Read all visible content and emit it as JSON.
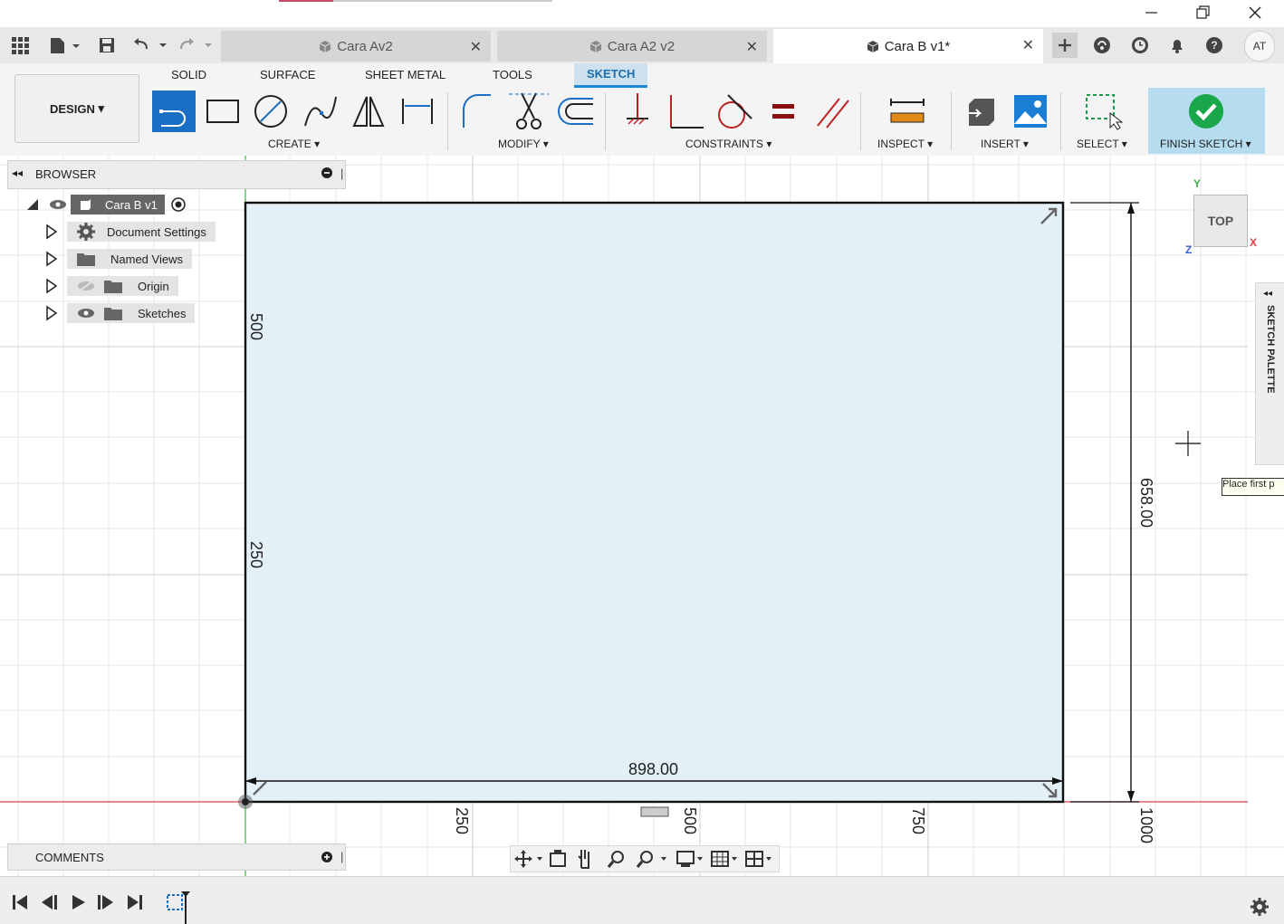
{
  "tabs": [
    {
      "label": "Cara Av2",
      "active": false
    },
    {
      "label": "Cara A2 v2",
      "active": false
    },
    {
      "label": "Cara B v1*",
      "active": true
    }
  ],
  "user_initials": "AT",
  "workspace_tabs": [
    "SOLID",
    "SURFACE",
    "SHEET METAL",
    "TOOLS",
    "SKETCH"
  ],
  "design_label": "DESIGN",
  "groups": {
    "create": "CREATE",
    "modify": "MODIFY",
    "constraints": "CONSTRAINTS",
    "inspect": "INSPECT",
    "insert": "INSERT",
    "select": "SELECT",
    "finish": "FINISH SKETCH"
  },
  "browser": {
    "title": "BROWSER",
    "root": "Cara B v1",
    "items": [
      "Document Settings",
      "Named Views",
      "Origin",
      "Sketches"
    ]
  },
  "comments_label": "COMMENTS",
  "viewcube": {
    "face": "TOP",
    "x": "X",
    "y": "Y",
    "z": "Z"
  },
  "sketch_palette": "SKETCH PALETTE",
  "tooltip": "Place first p",
  "dimensions": {
    "width": "898.00",
    "height": "658.00"
  },
  "ruler": {
    "x_ticks": [
      "250",
      "500",
      "750",
      "1000"
    ],
    "y_ticks": [
      "500",
      "250"
    ]
  },
  "colors": {
    "accent": "#1a8ad4",
    "finish_bg": "#b5dcef",
    "sketch_fill": "#e3f0f7",
    "check_green": "#1aa64a"
  }
}
